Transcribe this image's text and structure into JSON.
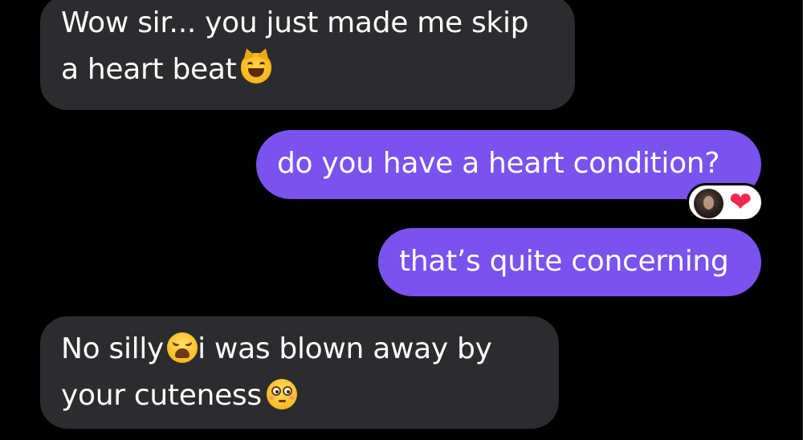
{
  "messages": [
    {
      "direction": "incoming",
      "line1": "Wow sir... you just made me skip",
      "line2": "a heart beat",
      "emoji": "grinning-cat-emoji"
    },
    {
      "direction": "outgoing",
      "text": "do you have a heart condition?"
    },
    {
      "direction": "outgoing",
      "text": "that’s quite concerning"
    },
    {
      "direction": "incoming",
      "line1_a": "No silly",
      "line1_emoji": "weary-face-emoji",
      "line1_b": "i was blown away by",
      "line2": "your cuteness",
      "emoji": "flushed-face-emoji"
    }
  ],
  "reaction": {
    "on_message": 1,
    "icon": "heart",
    "glyph": "❤"
  },
  "colors": {
    "background": "#000000",
    "incoming_bubble": "#2c2c2e",
    "outgoing_bubble": "#7a52ee",
    "text": "#ffffff",
    "reaction_heart": "#f0284a"
  }
}
